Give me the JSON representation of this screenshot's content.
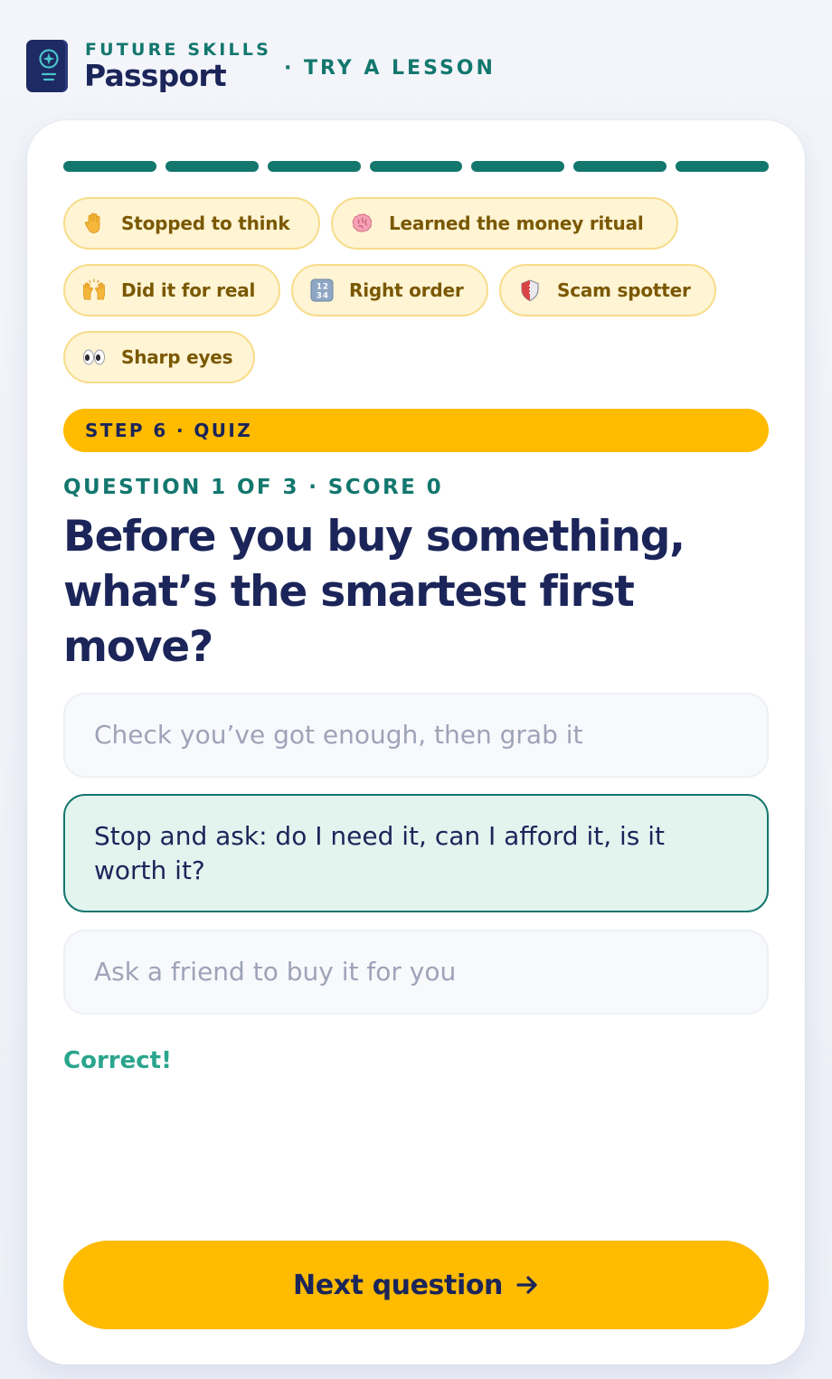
{
  "header": {
    "brand_top": "FUTURE SKILLS",
    "brand_main": "Passport",
    "section": "· TRY A LESSON",
    "logo_icon": "passport-icon"
  },
  "progress": {
    "segments_total": 7,
    "segments_complete": 7,
    "color": "#13776e"
  },
  "badges": [
    {
      "label": "Stopped to think",
      "icon": "raised-hand-icon"
    },
    {
      "label": "Learned the money ritual",
      "icon": "brain-icon"
    },
    {
      "label": "Did it for real",
      "icon": "raising-hands-icon"
    },
    {
      "label": "Right order",
      "icon": "numbers-1234-icon"
    },
    {
      "label": "Scam spotter",
      "icon": "shield-icon"
    },
    {
      "label": "Sharp eyes",
      "icon": "eyes-icon"
    }
  ],
  "step": {
    "label": "STEP 6 · QUIZ"
  },
  "quiz": {
    "meta": "QUESTION 1 OF 3 · SCORE 0",
    "question": "Before you buy something, what’s the smartest first move?",
    "answers": [
      {
        "text": "Check you’ve got enough, then grab it",
        "state": "dim"
      },
      {
        "text": "Stop and ask: do I need it, can I afford it, is it worth it?",
        "state": "correct"
      },
      {
        "text": "Ask a friend to buy it for you",
        "state": "dim"
      }
    ],
    "feedback": "Correct!"
  },
  "next_button": {
    "label": "Next question",
    "icon": "arrow-right-icon"
  },
  "colors": {
    "accent_teal": "#13776e",
    "accent_yellow": "#ffbb00",
    "navy": "#1b2559",
    "badge_bg": "#fff4d3",
    "correct_green": "#2aa58e"
  }
}
